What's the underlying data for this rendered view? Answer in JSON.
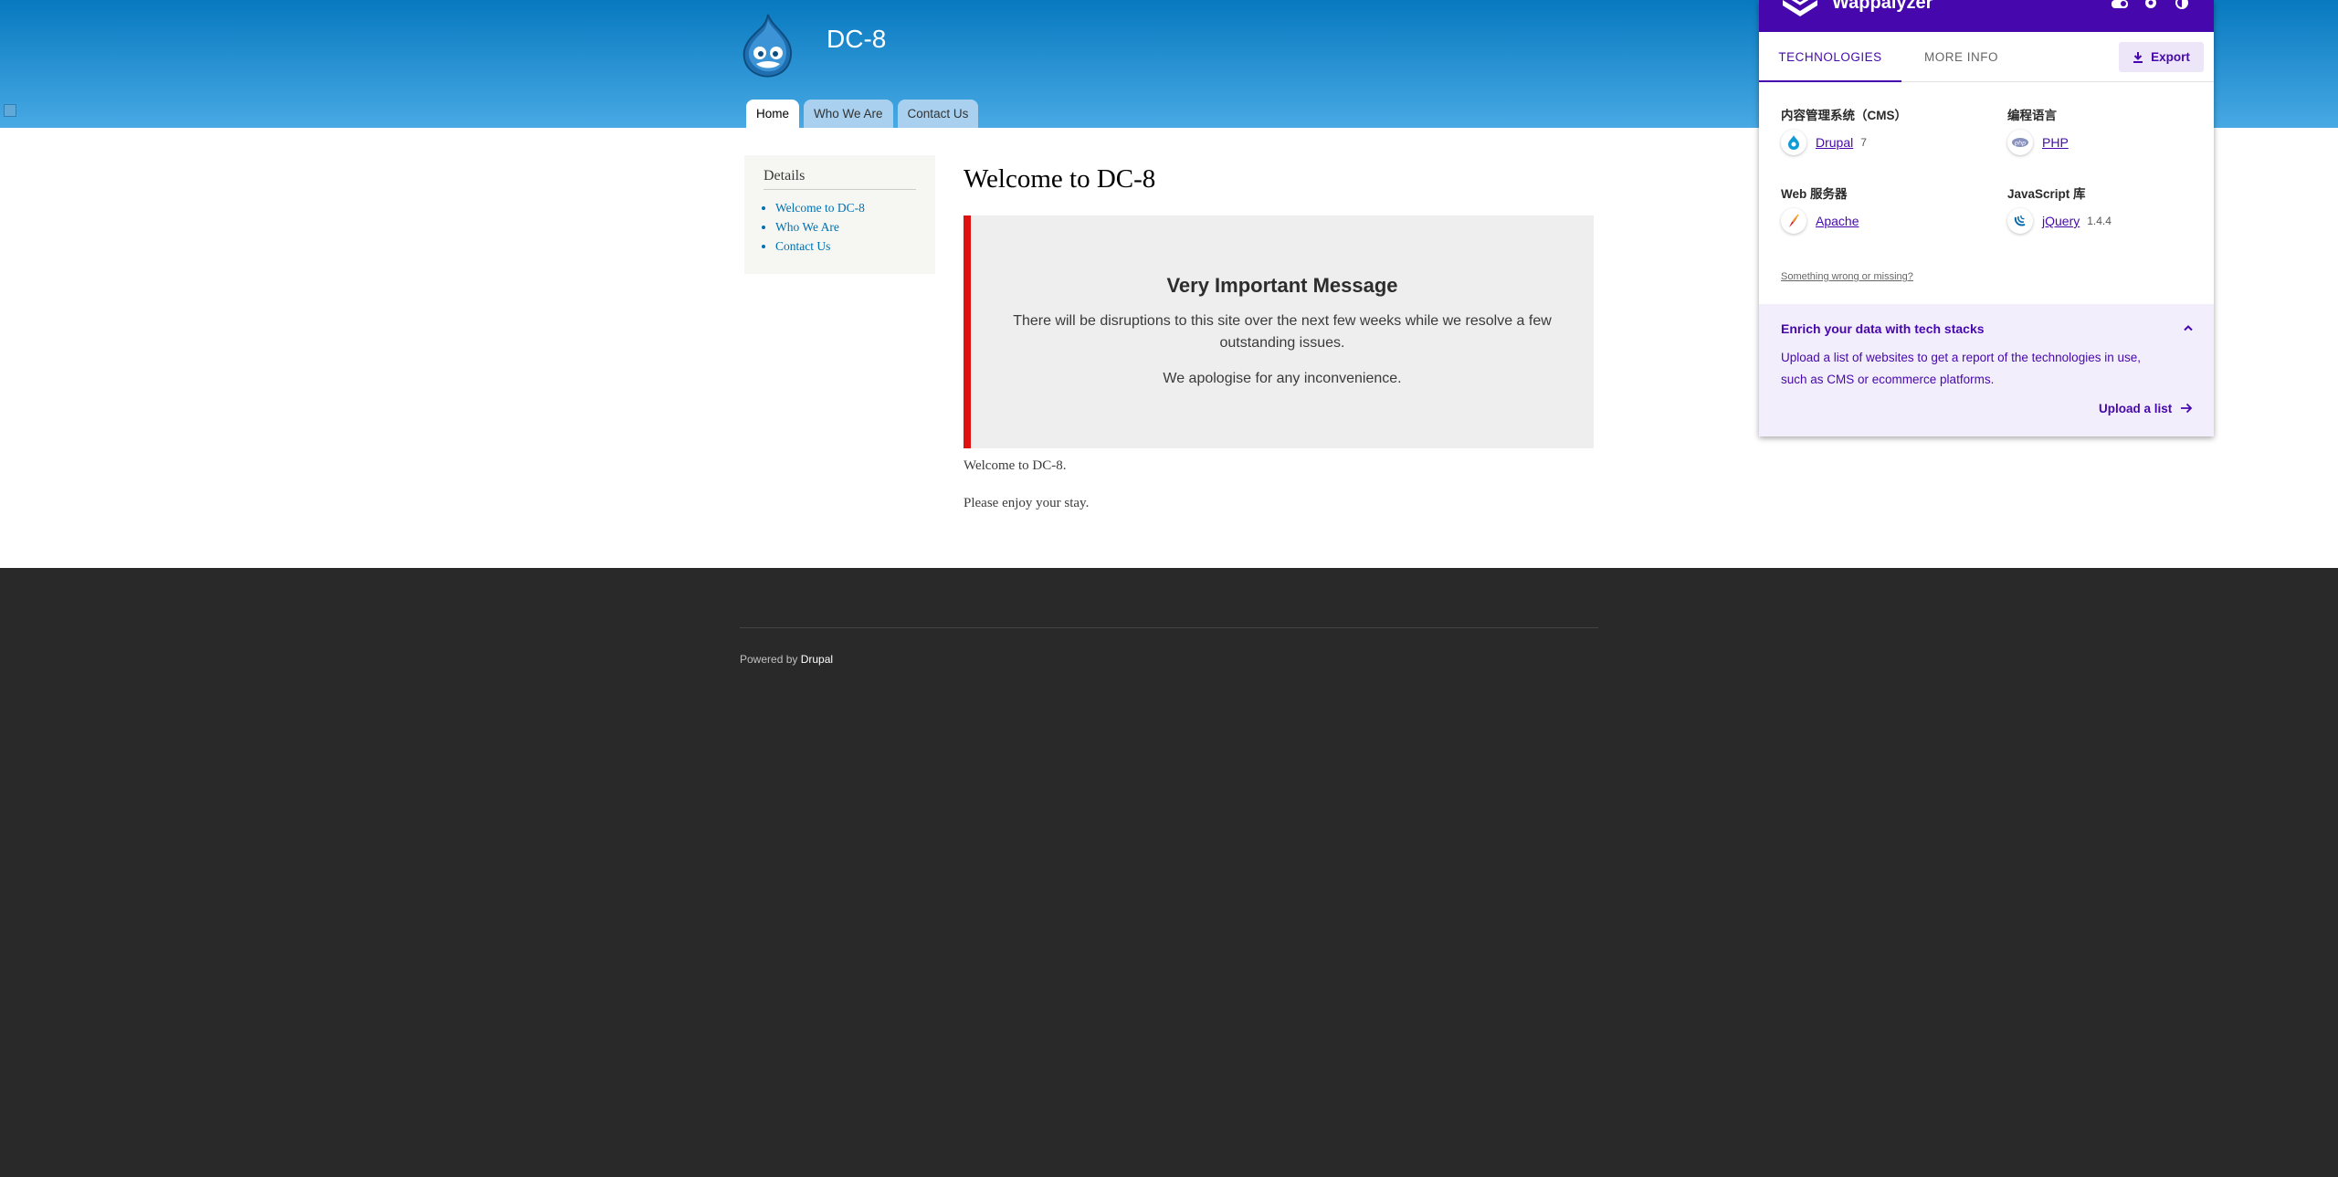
{
  "site": {
    "name": "DC-8",
    "tabs": [
      "Home",
      "Who We Are",
      "Contact Us"
    ]
  },
  "sidebar": {
    "title": "Details",
    "items": [
      "Welcome to DC-8",
      "Who We Are",
      "Contact Us"
    ]
  },
  "main": {
    "title": "Welcome to DC-8",
    "message": {
      "heading": "Very Important Message",
      "line1": "There will be disruptions to this site over the next few weeks while we resolve a few outstanding issues.",
      "line2": "We apologise for any inconvenience."
    },
    "p1": "Welcome to DC-8.",
    "p2": "Please enjoy your stay."
  },
  "footer": {
    "prefix": "Powered by",
    "link": "Drupal"
  },
  "wappalyzer": {
    "brand": "Wappalyzer",
    "tabs": {
      "technologies": "TECHNOLOGIES",
      "more_info": "MORE INFO"
    },
    "export_label": "Export",
    "categories": [
      {
        "name": "内容管理系统（CMS）",
        "tech": "Drupal",
        "version": "7",
        "icon": "drupal-icon"
      },
      {
        "name": "编程语言",
        "tech": "PHP",
        "version": "",
        "icon": "php-icon"
      },
      {
        "name": "Web 服务器",
        "tech": "Apache",
        "version": "",
        "icon": "apache-icon"
      },
      {
        "name": "JavaScript 库",
        "tech": "jQuery",
        "version": "1.4.4",
        "icon": "jquery-icon"
      }
    ],
    "missing_link": "Something wrong or missing?",
    "enrich": {
      "title": "Enrich your data with tech stacks",
      "text": "Upload a list of websites to get a report of the technologies in use, such as CMS or ecommerce platforms.",
      "upload_label": "Upload a list"
    }
  },
  "colors": {
    "header_top": "#0779bf",
    "header_bottom": "#48a9e4",
    "message_border": "#e01111",
    "wappalyzer_purple": "#4608ad",
    "footer_bg": "#292929"
  }
}
